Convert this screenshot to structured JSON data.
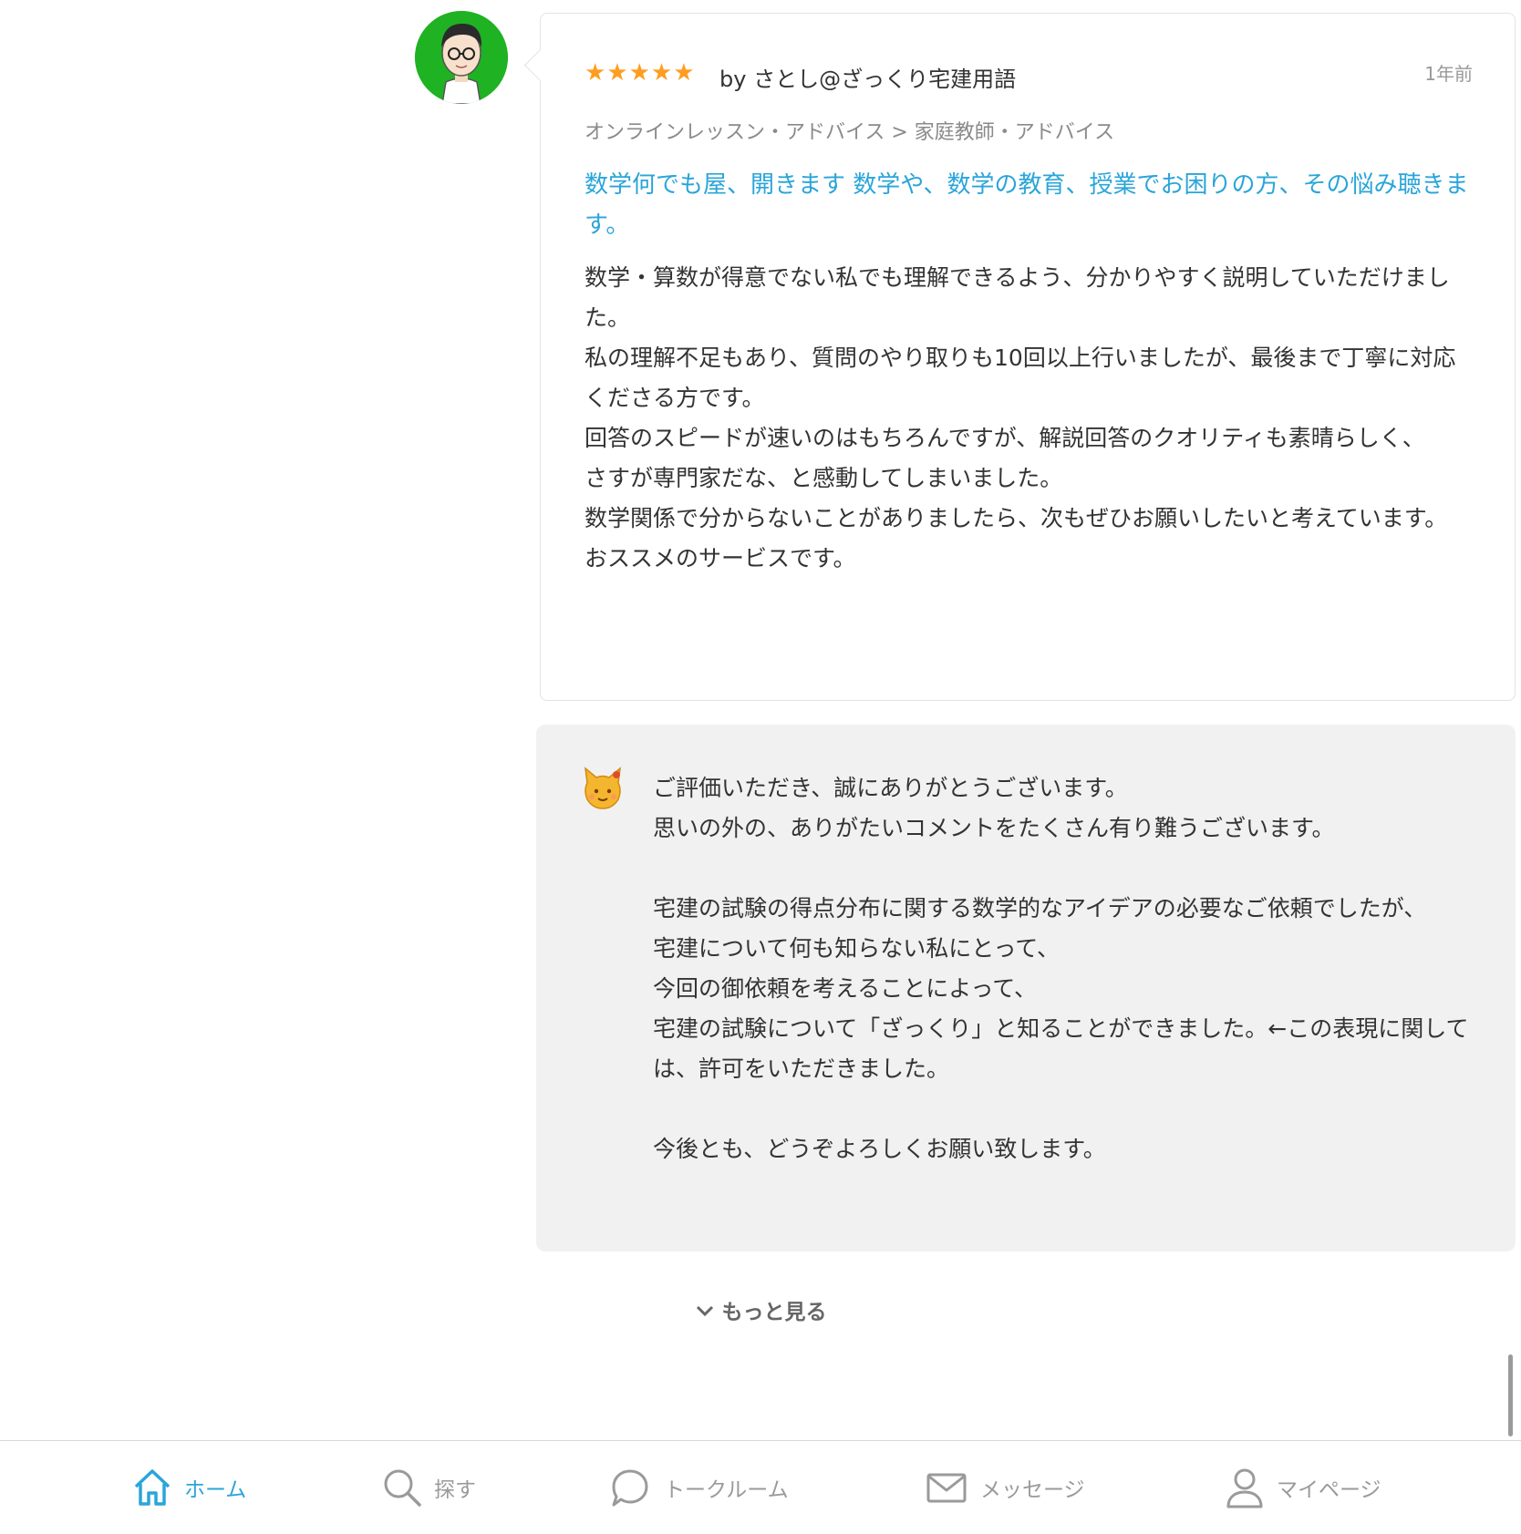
{
  "review": {
    "rating": 5,
    "stars_text": "★★★★★",
    "reviewer": "by さとし@ざっくり宅建用語",
    "time_ago": "1年前",
    "category": "オンラインレッスン・アドバイス > 家庭教師・アドバイス",
    "service_title": "数学何でも屋、開きます 数学や、数学の教育、授業でお困りの方、その悩み聴きます。",
    "body": [
      "数学・算数が得意でない私でも理解できるよう、分かりやすく説明していただけました。",
      "私の理解不足もあり、質問のやり取りも10回以上行いましたが、最後まで丁寧に対応くださる方です。",
      "回答のスピードが速いのはもちろんですが、解説回答のクオリティも素晴らしく、",
      "さすが専門家だな、と感動してしまいました。",
      "数学関係で分からないことがありましたら、次もぜひお願いしたいと考えています。",
      "おススメのサービスです。"
    ]
  },
  "reply": {
    "body": [
      "ご評価いただき、誠にありがとうございます。",
      "思いの外の、ありがたいコメントをたくさん有り難うございます。",
      "",
      "宅建の試験の得点分布に関する数学的なアイデアの必要なご依頼でしたが、",
      "宅建について何も知らない私にとって、",
      "今回の御依頼を考えることによって、",
      "宅建の試験について「ざっくり」と知ることができました。←この表現に関しては、許可をいただきました。",
      "",
      "今後とも、どうぞよろしくお願い致します。"
    ]
  },
  "more": {
    "label": "もっと見る",
    "chevron": "chevron-down-icon"
  },
  "tabbar": {
    "items": [
      {
        "label": "ホーム",
        "icon": "home-icon",
        "active": true
      },
      {
        "label": "探す",
        "icon": "search-icon",
        "active": false
      },
      {
        "label": "トークルーム",
        "icon": "chat-bubble-icon",
        "active": false
      },
      {
        "label": "メッセージ",
        "icon": "mail-icon",
        "active": false
      },
      {
        "label": "マイページ",
        "icon": "user-icon",
        "active": false
      }
    ]
  },
  "colors": {
    "accent": "#2aa5d9",
    "star": "#ff9d1f",
    "avatar_bg": "#1fb223",
    "reply_bg": "#f1f1f1"
  }
}
